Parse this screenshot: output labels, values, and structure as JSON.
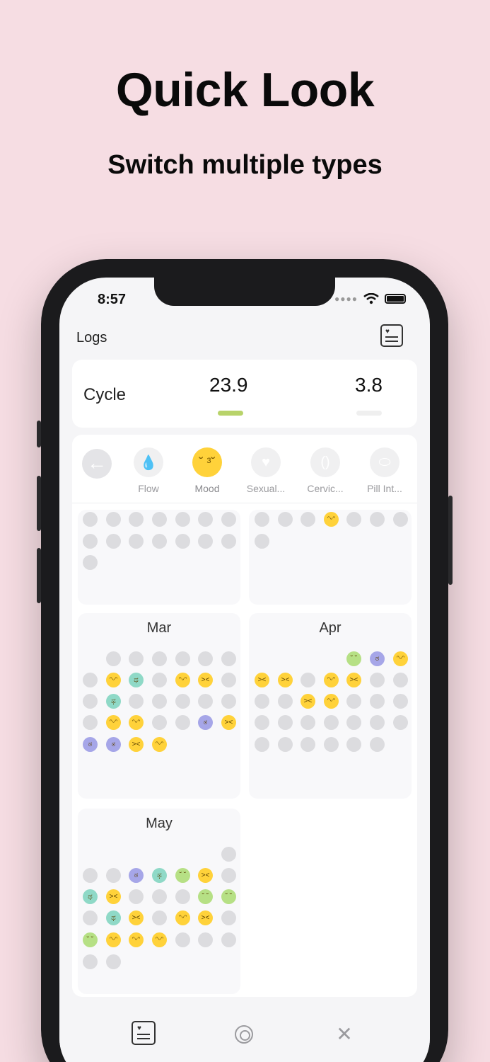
{
  "headline": "Quick Look",
  "subheadline": "Switch multiple types",
  "status": {
    "time": "8:57"
  },
  "nav": {
    "title": "Logs",
    "icon": "logbook-icon"
  },
  "cycle": {
    "label": "Cycle",
    "value_primary": "23.9",
    "value_secondary": "3.8"
  },
  "types": [
    {
      "label": "Flow",
      "icon": "drop-icon"
    },
    {
      "label": "Mood",
      "icon": "mood-face-icon",
      "selected": true
    },
    {
      "label": "Sexual...",
      "icon": "heart-icon"
    },
    {
      "label": "Cervic...",
      "icon": "cervical-icon"
    },
    {
      "label": "Pill Int...",
      "icon": "pill-icon"
    }
  ],
  "months": [
    {
      "title": "",
      "dots": 15
    },
    {
      "title": "",
      "dots": 8
    },
    {
      "title": "Mar"
    },
    {
      "title": "Apr"
    },
    {
      "title": "May"
    }
  ],
  "tabs": [
    {
      "name": "logs",
      "icon": "logbook-icon"
    },
    {
      "name": "track",
      "icon": "target-icon"
    },
    {
      "name": "tools",
      "icon": "tools-icon"
    }
  ],
  "colors": {
    "background": "#f6dde3",
    "accent": "#b8d36a",
    "mood_yellow": "#ffd23a"
  }
}
